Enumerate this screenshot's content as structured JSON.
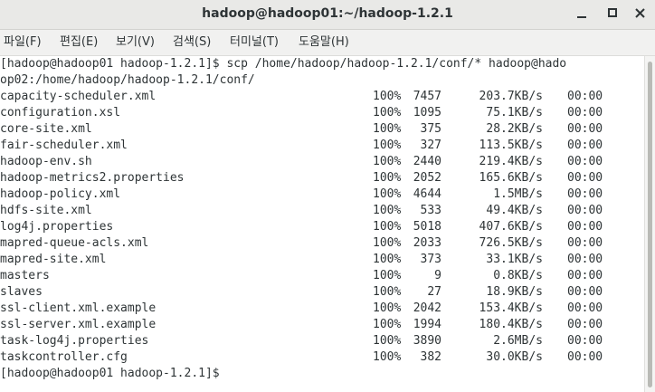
{
  "window": {
    "title": "hadoop@hadoop01:~/hadoop-1.2.1"
  },
  "menu": {
    "items": [
      "파일(F)",
      "편집(E)",
      "보기(V)",
      "검색(S)",
      "터미널(T)",
      "도움말(H)"
    ]
  },
  "icons": {
    "minimize": "minimize-icon",
    "maximize": "maximize-icon",
    "close": "close-icon"
  },
  "terminal": {
    "command_line_1": "[hadoop@hadoop01 hadoop-1.2.1]$ scp /home/hadoop/hadoop-1.2.1/conf/* hadoop@hado",
    "command_line_2": "op02:/home/hadoop/hadoop-1.2.1/conf/",
    "files": [
      {
        "name": "capacity-scheduler.xml",
        "pct": "100%",
        "size": "7457",
        "rate": "203.7KB/s",
        "time": "00:00"
      },
      {
        "name": "configuration.xsl",
        "pct": "100%",
        "size": "1095",
        "rate": "75.1KB/s",
        "time": "00:00"
      },
      {
        "name": "core-site.xml",
        "pct": "100%",
        "size": "375",
        "rate": "28.2KB/s",
        "time": "00:00"
      },
      {
        "name": "fair-scheduler.xml",
        "pct": "100%",
        "size": "327",
        "rate": "113.5KB/s",
        "time": "00:00"
      },
      {
        "name": "hadoop-env.sh",
        "pct": "100%",
        "size": "2440",
        "rate": "219.4KB/s",
        "time": "00:00"
      },
      {
        "name": "hadoop-metrics2.properties",
        "pct": "100%",
        "size": "2052",
        "rate": "165.6KB/s",
        "time": "00:00"
      },
      {
        "name": "hadoop-policy.xml",
        "pct": "100%",
        "size": "4644",
        "rate": "1.5MB/s",
        "time": "00:00"
      },
      {
        "name": "hdfs-site.xml",
        "pct": "100%",
        "size": "533",
        "rate": "49.4KB/s",
        "time": "00:00"
      },
      {
        "name": "log4j.properties",
        "pct": "100%",
        "size": "5018",
        "rate": "407.6KB/s",
        "time": "00:00"
      },
      {
        "name": "mapred-queue-acls.xml",
        "pct": "100%",
        "size": "2033",
        "rate": "726.5KB/s",
        "time": "00:00"
      },
      {
        "name": "mapred-site.xml",
        "pct": "100%",
        "size": "373",
        "rate": "33.1KB/s",
        "time": "00:00"
      },
      {
        "name": "masters",
        "pct": "100%",
        "size": "9",
        "rate": "0.8KB/s",
        "time": "00:00"
      },
      {
        "name": "slaves",
        "pct": "100%",
        "size": "27",
        "rate": "18.9KB/s",
        "time": "00:00"
      },
      {
        "name": "ssl-client.xml.example",
        "pct": "100%",
        "size": "2042",
        "rate": "153.4KB/s",
        "time": "00:00"
      },
      {
        "name": "ssl-server.xml.example",
        "pct": "100%",
        "size": "1994",
        "rate": "180.4KB/s",
        "time": "00:00"
      },
      {
        "name": "task-log4j.properties",
        "pct": "100%",
        "size": "3890",
        "rate": "2.6MB/s",
        "time": "00:00"
      },
      {
        "name": "taskcontroller.cfg",
        "pct": "100%",
        "size": "382",
        "rate": "30.0KB/s",
        "time": "00:00"
      }
    ],
    "prompt": "[hadoop@hadoop01 hadoop-1.2.1]$ "
  }
}
